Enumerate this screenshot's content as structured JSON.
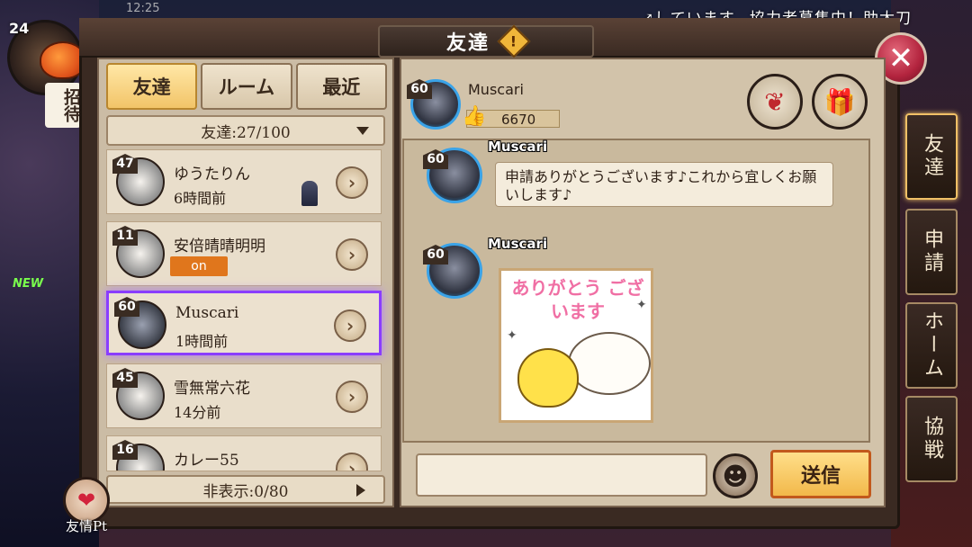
{
  "status_bar": {
    "time": "12:25"
  },
  "ticker": {
    "text": "↗しています。協力者募集中！助太刀"
  },
  "player": {
    "level": "24"
  },
  "invite": {
    "label": "招待"
  },
  "new_tag": "NEW",
  "friend_pt": {
    "label": "友情Pt"
  },
  "panel": {
    "title": "友達",
    "info_icon": "!",
    "close_icon": "✕"
  },
  "tabs": [
    {
      "label": "友達",
      "active": true
    },
    {
      "label": "ルーム",
      "active": false
    },
    {
      "label": "最近",
      "active": false
    }
  ],
  "friend_count": {
    "label": "友達:27/100"
  },
  "friends": [
    {
      "level": "47",
      "name": "ゆうたりん",
      "status": "6時間前",
      "status_type": "time",
      "icon": "chess-piece-icon"
    },
    {
      "level": "11",
      "name": "安倍晴晴明明",
      "status": "on",
      "status_type": "online"
    },
    {
      "level": "60",
      "name": "Muscari",
      "status": "1時間前",
      "status_type": "time",
      "selected": true
    },
    {
      "level": "45",
      "name": "雪無常六花",
      "status": "14分前",
      "status_type": "time"
    },
    {
      "level": "16",
      "name": "カレー55",
      "status": "",
      "status_type": "time"
    }
  ],
  "hidden_count": {
    "label": "非表示:0/80"
  },
  "chat": {
    "header": {
      "level": "60",
      "name": "Muscari",
      "likes": "6670"
    },
    "gifts": [
      "gift-red-icon",
      "gift-bag-icon"
    ],
    "messages": [
      {
        "level": "60",
        "name": "Muscari",
        "text": "申請ありがとうございます♪これから宜しくお願いします♪"
      },
      {
        "level": "60",
        "name": "Muscari",
        "sticker_text": "ありがとう ございます"
      }
    ],
    "input": {
      "placeholder": "",
      "value": ""
    },
    "send_label": "送信",
    "emoji_icon": "face-icon"
  },
  "side_tabs": [
    {
      "label": "友達",
      "active": true
    },
    {
      "label": "申請",
      "active": false
    },
    {
      "label": "ホーム",
      "active": false
    },
    {
      "label": "協戦",
      "active": false
    }
  ]
}
